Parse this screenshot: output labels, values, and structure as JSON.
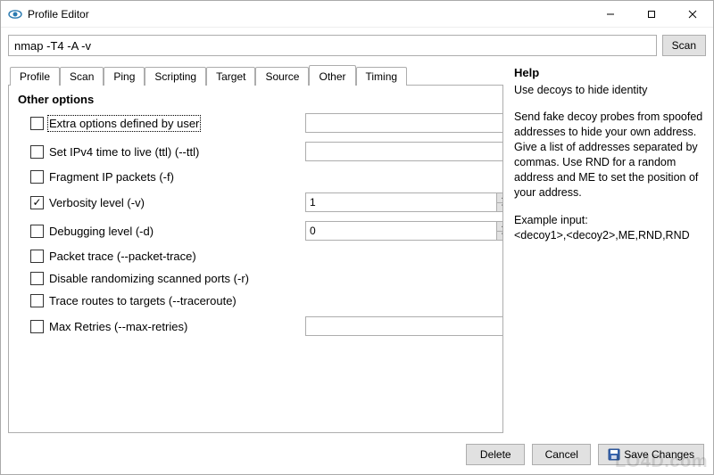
{
  "window": {
    "title": "Profile Editor"
  },
  "command": {
    "value": "nmap -T4 -A -v",
    "scan_label": "Scan"
  },
  "tabs": [
    "Profile",
    "Scan",
    "Ping",
    "Scripting",
    "Target",
    "Source",
    "Other",
    "Timing"
  ],
  "active_tab_index": 6,
  "section_title": "Other options",
  "options": [
    {
      "label": "Extra options defined by user",
      "checked": false,
      "dotted": true,
      "control": "text",
      "value": ""
    },
    {
      "label": "Set IPv4 time to live (ttl) (--ttl)",
      "checked": false,
      "control": "text",
      "value": ""
    },
    {
      "label": "Fragment IP packets (-f)",
      "checked": false,
      "control": "none"
    },
    {
      "label": "Verbosity level (-v)",
      "checked": true,
      "control": "spinner",
      "value": "1"
    },
    {
      "label": "Debugging level (-d)",
      "checked": false,
      "control": "spinner",
      "value": "0"
    },
    {
      "label": "Packet trace (--packet-trace)",
      "checked": false,
      "control": "none"
    },
    {
      "label": "Disable randomizing scanned ports (-r)",
      "checked": false,
      "control": "none"
    },
    {
      "label": "Trace routes to targets (--traceroute)",
      "checked": false,
      "control": "none"
    },
    {
      "label": "Max Retries (--max-retries)",
      "checked": false,
      "control": "text",
      "value": ""
    }
  ],
  "help": {
    "title": "Help",
    "subtitle": "Use decoys to hide identity",
    "body": "Send fake decoy probes from spoofed addresses to hide your own address. Give a list of addresses separated by commas. Use RND for a random address and ME to set the position of your address.",
    "example_label": "Example input:",
    "example": "<decoy1>,<decoy2>,ME,RND,RND"
  },
  "footer": {
    "delete": "Delete",
    "cancel": "Cancel",
    "save": "Save Changes"
  },
  "watermark": "LO4D.com"
}
